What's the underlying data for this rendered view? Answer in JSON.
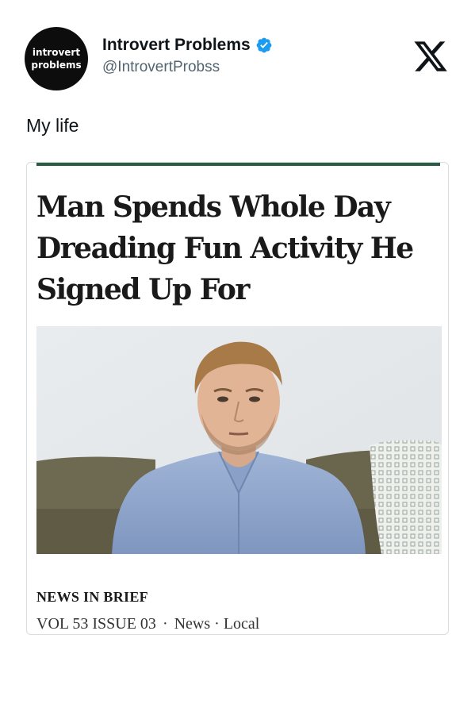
{
  "tweet": {
    "avatar_line1": "introvert",
    "avatar_line2": "problems",
    "display_name": "Introvert Problems",
    "handle": "@IntrovertProbss",
    "text": "My life",
    "verified_icon": "verified-badge-icon",
    "platform_icon": "x-logo-icon"
  },
  "article": {
    "headline": "Man Spends Whole Day Dreading Fun Activity He Signed Up For",
    "photo": "photo of a man in a blue button-up shirt sitting on a couch",
    "section": "NEWS IN BRIEF",
    "issue": "VOL 53 ISSUE 03",
    "separator": "·",
    "tag_news": "News",
    "tag_separator": "·",
    "tag_local": "Local"
  },
  "colors": {
    "accent_rule": "#285c45",
    "verified_blue": "#1d9bf0",
    "handle_gray": "#536471"
  }
}
